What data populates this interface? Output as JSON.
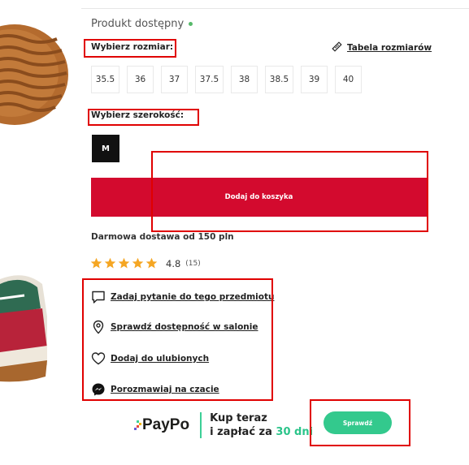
{
  "availability": {
    "text": "Produkt dostępny"
  },
  "size": {
    "label": "Wybierz rozmiar:",
    "guide_label": "Tabela rozmiarów",
    "options": [
      "35.5",
      "36",
      "37",
      "37.5",
      "38",
      "38.5",
      "39",
      "40"
    ]
  },
  "width": {
    "label": "Wybierz szerokość:",
    "selected": "M"
  },
  "cart": {
    "button_label": "Dodaj do koszyka"
  },
  "shipping": {
    "text": "Darmowa dostawa od 150 pln"
  },
  "rating": {
    "score": "4.8",
    "count": "(15)",
    "stars": 5
  },
  "actions": [
    {
      "label": "Zadaj pytanie do tego przedmiotu",
      "icon": "chat-bubble-icon"
    },
    {
      "label": "Sprawdź dostępność w salonie",
      "icon": "location-pin-icon"
    },
    {
      "label": "Dodaj do ulubionych",
      "icon": "heart-icon"
    },
    {
      "label": "Porozmawiaj na czacie",
      "icon": "messenger-icon"
    }
  ],
  "paypo": {
    "logo": "PayPo",
    "line1": "Kup teraz",
    "line2_prefix": "i zapłać za ",
    "line2_highlight": "30 dni",
    "button_label": "Sprawdź"
  },
  "colors": {
    "accent": "#d30a2e",
    "paypo_green": "#33c98d",
    "highlight": "#e00000",
    "star": "#f5a623"
  }
}
